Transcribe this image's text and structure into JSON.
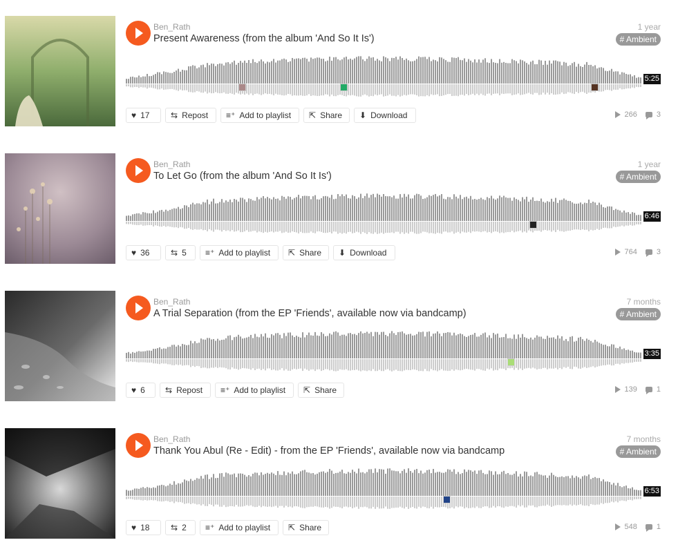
{
  "tracks": [
    {
      "username": "Ben_Rath",
      "title": "Present Awareness (from the album 'And So It Is')",
      "age": "1 year",
      "tag": "# Ambient",
      "duration": "5:25",
      "likes": "17",
      "repost_label": "Repost",
      "reposts": "",
      "add_to_playlist": "Add to playlist",
      "share": "Share",
      "download": "Download",
      "plays": "266",
      "comments": "3",
      "artwork_colors": [
        "#c8c99a",
        "#7e9a62",
        "#3f5a35"
      ]
    },
    {
      "username": "Ben_Rath",
      "title": "To Let Go (from the album 'And So It Is')",
      "age": "1 year",
      "tag": "# Ambient",
      "duration": "6:46",
      "likes": "36",
      "repost_label": "",
      "reposts": "5",
      "add_to_playlist": "Add to playlist",
      "share": "Share",
      "download": "Download",
      "plays": "764",
      "comments": "3",
      "artwork_colors": [
        "#b8a6b0",
        "#8e7e8a",
        "#c9b6a5"
      ]
    },
    {
      "username": "Ben_Rath",
      "title": "A Trial Separation (from the EP 'Friends', available now via bandcamp)",
      "age": "7 months",
      "tag": "# Ambient",
      "duration": "3:35",
      "likes": "6",
      "repost_label": "Repost",
      "reposts": "",
      "add_to_playlist": "Add to playlist",
      "share": "Share",
      "download": "",
      "plays": "139",
      "comments": "1",
      "artwork_colors": [
        "#2e2e2e",
        "#8a8a8a",
        "#e0e0e0"
      ]
    },
    {
      "username": "Ben_Rath",
      "title": "Thank You Abul (Re - Edit) - from the EP 'Friends', available now via bandcamp",
      "age": "7 months",
      "tag": "# Ambient",
      "duration": "6:53",
      "likes": "18",
      "repost_label": "",
      "reposts": "2",
      "add_to_playlist": "Add to playlist",
      "share": "Share",
      "download": "",
      "plays": "548",
      "comments": "1",
      "artwork_colors": [
        "#1e1e1e",
        "#9a9a9a",
        "#d8d8d8"
      ]
    }
  ],
  "colors": {
    "accent": "#f55a1f",
    "waveform": "#999999",
    "waveform_reflection": "#cccccc"
  }
}
